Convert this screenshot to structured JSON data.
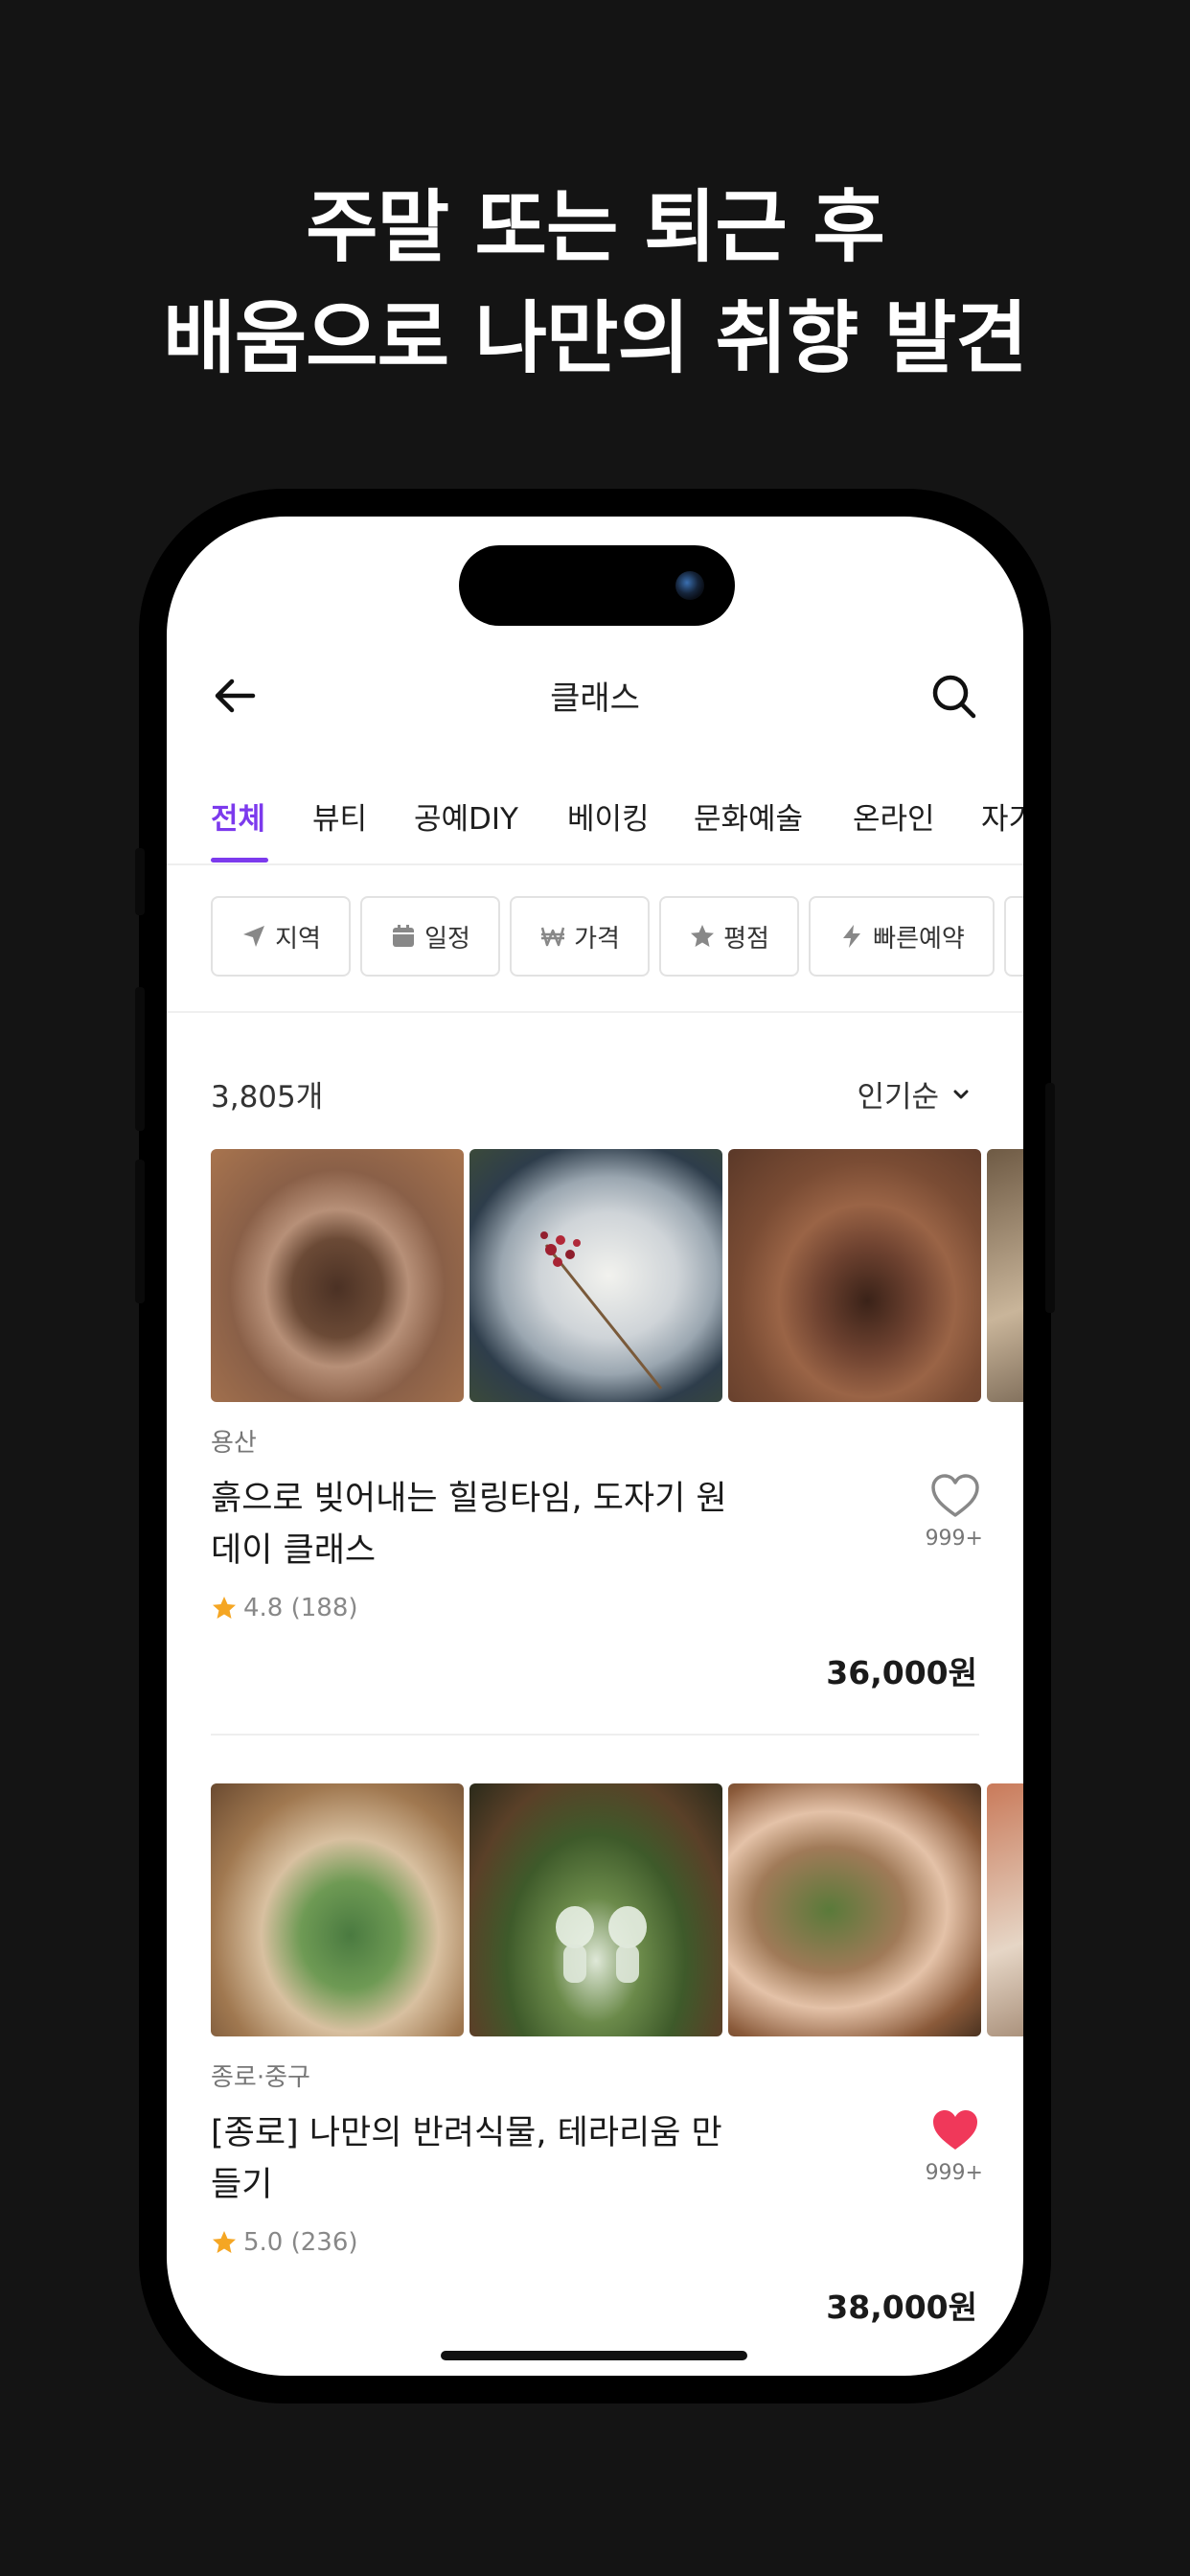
{
  "headline": {
    "line1": "주말 또는 퇴근 후",
    "line2": "배움으로 나만의 취향 발견"
  },
  "header": {
    "title": "클래스"
  },
  "tabs": [
    {
      "label": "전체",
      "active": true
    },
    {
      "label": "뷰티"
    },
    {
      "label": "공예DIY"
    },
    {
      "label": "베이킹"
    },
    {
      "label": "문화예술"
    },
    {
      "label": "온라인"
    },
    {
      "label": "자기계발"
    }
  ],
  "filters": [
    {
      "label": "지역",
      "icon": "location-arrow-icon"
    },
    {
      "label": "일정",
      "icon": "calendar-icon"
    },
    {
      "label": "가격",
      "icon": "won-icon"
    },
    {
      "label": "평점",
      "icon": "star-icon"
    },
    {
      "label": "빠른예약",
      "icon": "lightning-icon"
    }
  ],
  "results": {
    "count": "3,805개",
    "sort": "인기순"
  },
  "classes": [
    {
      "location": "용산",
      "title": "흙으로 빚어내는 힐링타임, 도자기 원데이 클래스",
      "rating": "4.8 (188)",
      "likes": "999+",
      "liked": false,
      "price": "36,000원"
    },
    {
      "location": "종로·중구",
      "title": "[종로] 나만의 반려식물, 테라리움 만들기",
      "rating": "5.0 (236)",
      "likes": "999+",
      "liked": true,
      "price": "38,000원"
    }
  ],
  "colors": {
    "accent": "#7c3aed",
    "heart": "#f0385a",
    "star": "#f5a623",
    "background": "#141414"
  }
}
